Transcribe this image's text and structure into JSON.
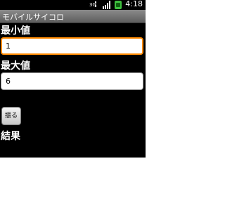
{
  "status_bar": {
    "time": "4:18",
    "icons": [
      "3g-signal-icon",
      "signal-strength-icon",
      "battery-icon"
    ],
    "network_label": "3G"
  },
  "app": {
    "title": "モバイルサイコロ"
  },
  "form": {
    "min_label": "最小値",
    "min_value": "1",
    "max_label": "最大値",
    "max_value": "6",
    "roll_button_label": "振る",
    "result_label": "結果"
  },
  "colors": {
    "focus_border": "#ff8a00",
    "background": "#000000",
    "title_bar": "#6e6e6e",
    "battery_green": "#3fbf3f"
  }
}
